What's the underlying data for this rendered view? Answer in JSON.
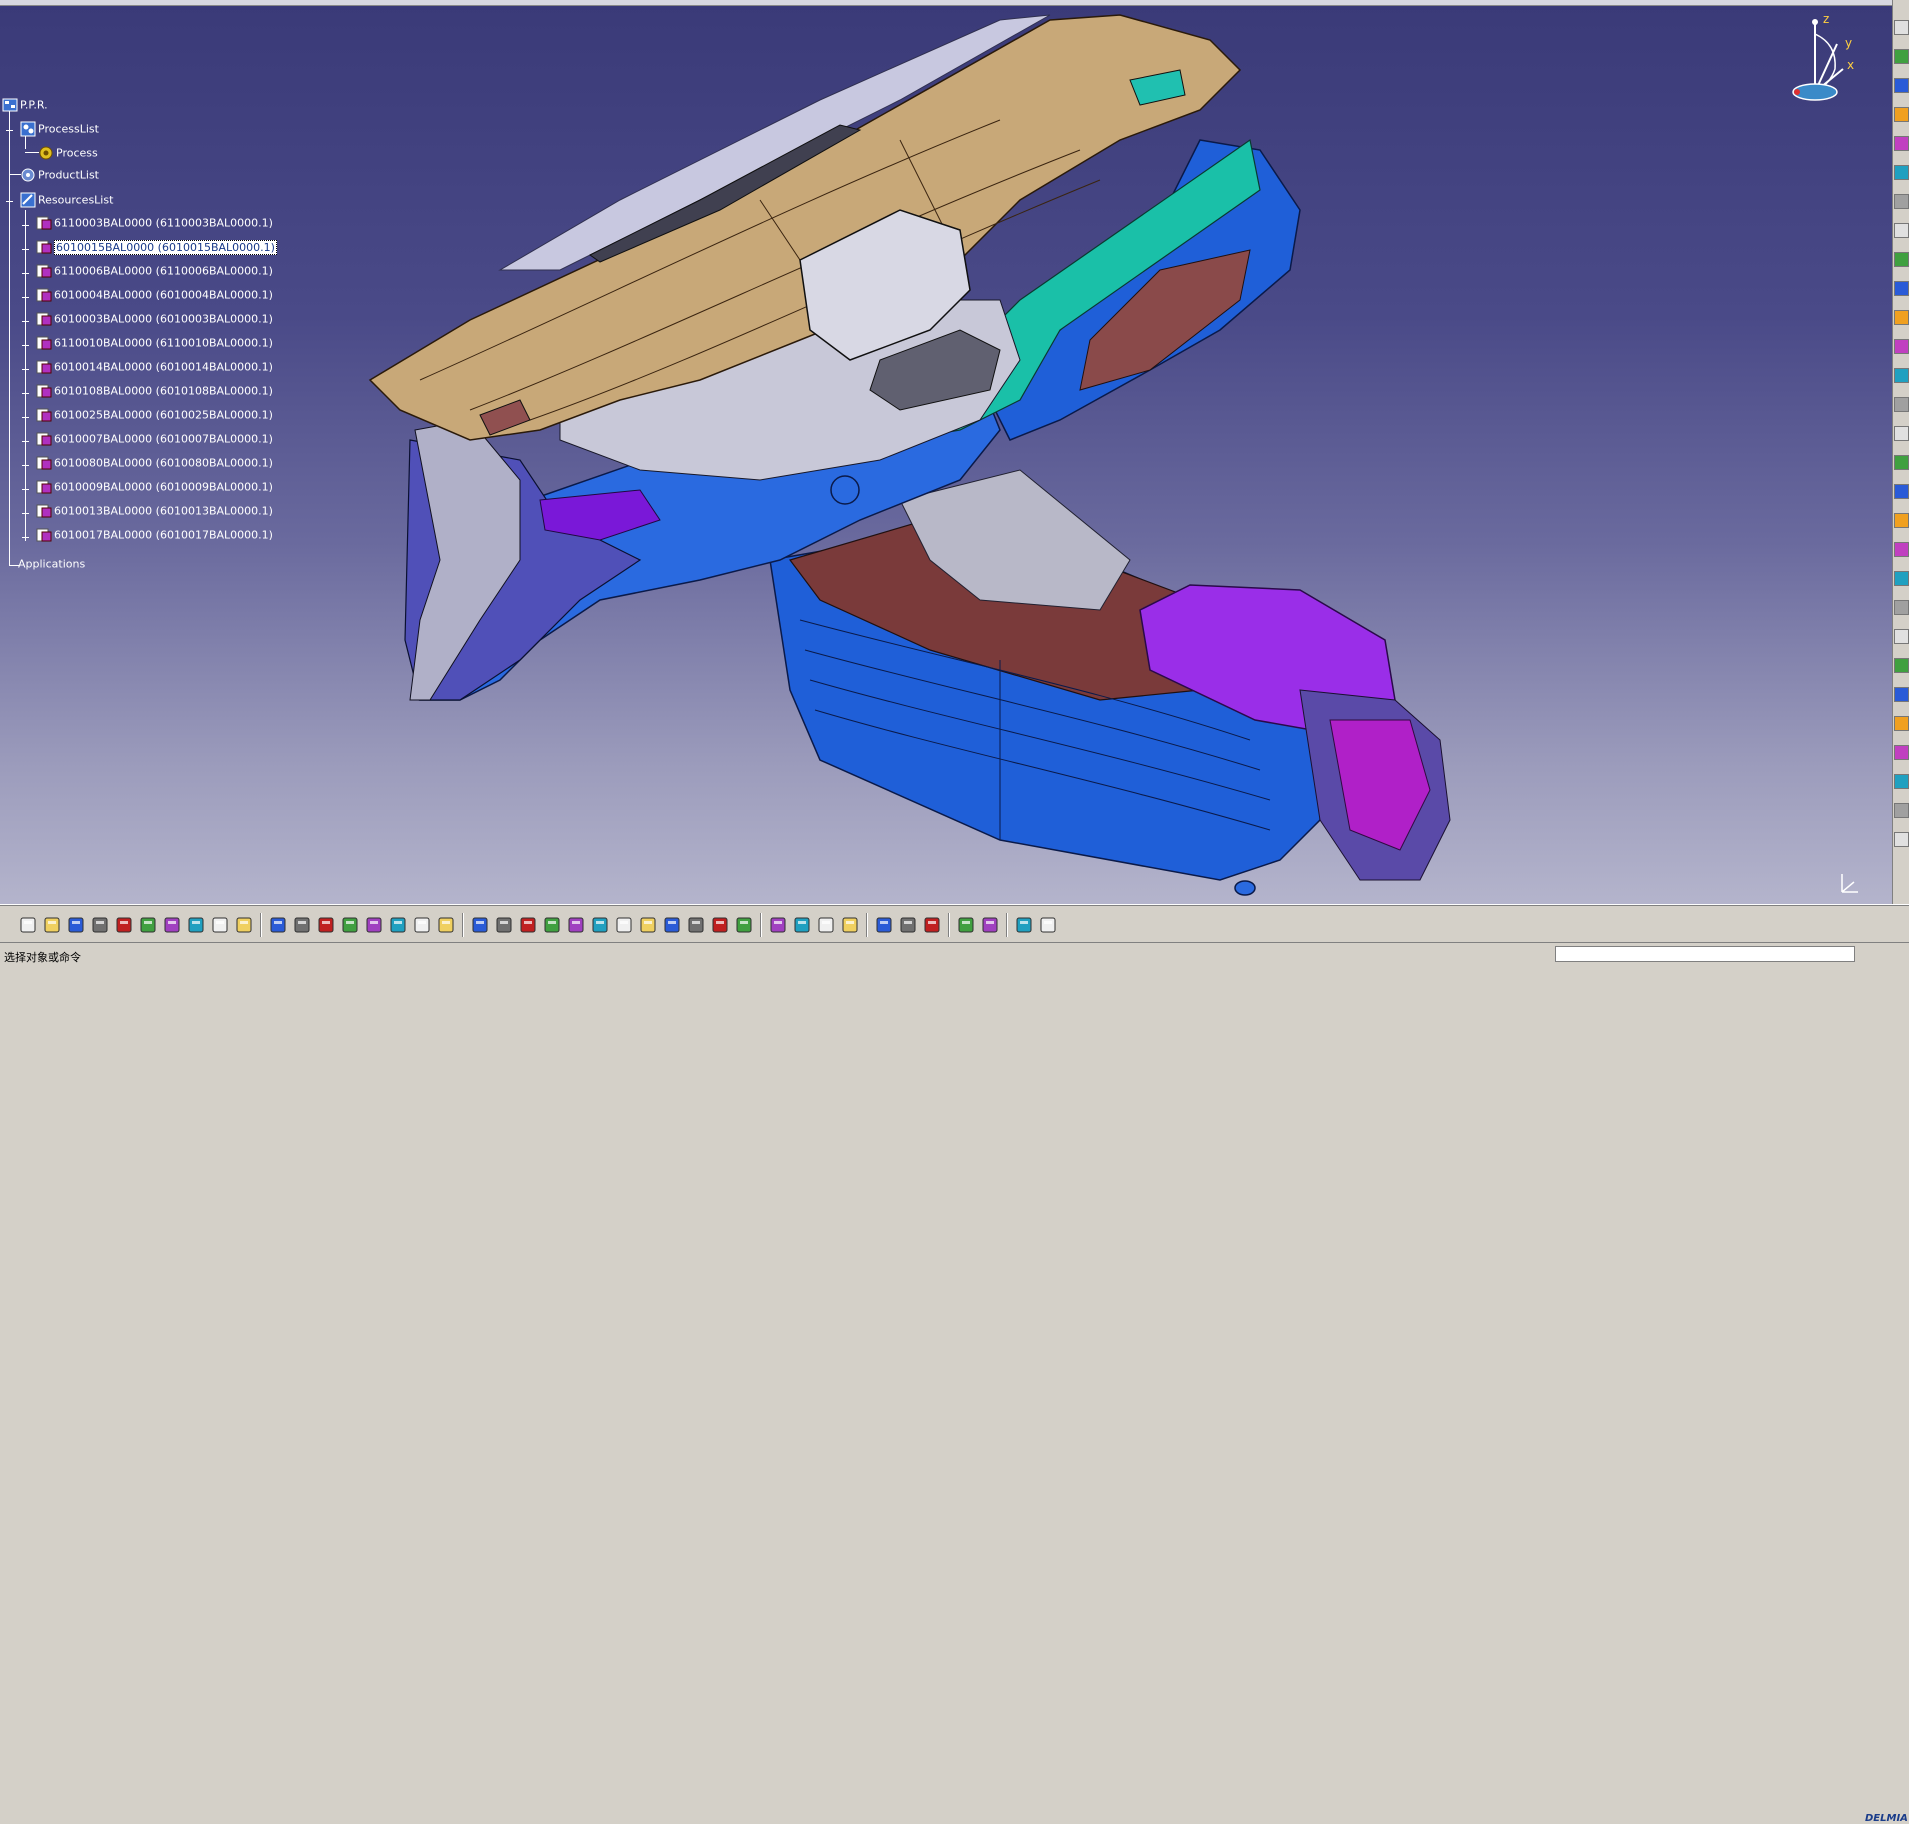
{
  "tree": {
    "root": "P.P.R.",
    "process_list": "ProcessList",
    "process": "Process",
    "product_list": "ProductList",
    "resources_list": "ResourcesList",
    "resources": [
      "6110003BAL0000 (6110003BAL0000.1)",
      "6010015BAL0000 (6010015BAL0000.1)",
      "6110006BAL0000 (6110006BAL0000.1)",
      "6010004BAL0000 (6010004BAL0000.1)",
      "6010003BAL0000 (6010003BAL0000.1)",
      "6110010BAL0000 (6110010BAL0000.1)",
      "6010014BAL0000 (6010014BAL0000.1)",
      "6010108BAL0000 (6010108BAL0000.1)",
      "6010025BAL0000 (6010025BAL0000.1)",
      "6010007BAL0000 (6010007BAL0000.1)",
      "6010080BAL0000 (6010080BAL0000.1)",
      "6010009BAL0000 (6010009BAL0000.1)",
      "6010013BAL0000 (6010013BAL0000.1)",
      "6010017BAL0000 (6010017BAL0000.1)"
    ],
    "selected_index": 1,
    "applications": "Applications"
  },
  "compass": {
    "z": "z",
    "y": "y",
    "x": "x"
  },
  "statusbar": {
    "prompt": "选择对象或命令",
    "command_value": ""
  },
  "logo": "DELMIA",
  "bottom_toolbar": {
    "icons": [
      "new-icon",
      "open-icon",
      "save-icon",
      "print-icon",
      "cut-icon",
      "copy-icon",
      "paste-icon",
      "undo-icon",
      "redo-icon",
      "whats-this-icon",
      "formula-icon",
      "knowledge-advisor-icon",
      "sketch-icon",
      "table-icon",
      "graph-icon",
      "measure-icon",
      "lock-icon",
      "analysis-icon",
      "fly-mode-icon",
      "fit-all-icon",
      "pan-icon",
      "rotate-icon",
      "zoom-in-icon",
      "zoom-out-icon",
      "normal-view-icon",
      "multi-view-icon",
      "iso-view-icon",
      "render-style-icon",
      "hide-show-icon",
      "swap-space-icon",
      "capture-icon",
      "catalog-icon",
      "clash-icon",
      "section-icon",
      "distance-icon",
      "refresh-icon",
      "scene-icon",
      "simulation-icon",
      "track-icon",
      "sequence-icon",
      "grid-icon"
    ],
    "colors": {
      "accent": "#2a5bd7",
      "viewport_top": "#3a3a78",
      "viewport_bottom": "#b4b4cc"
    }
  }
}
